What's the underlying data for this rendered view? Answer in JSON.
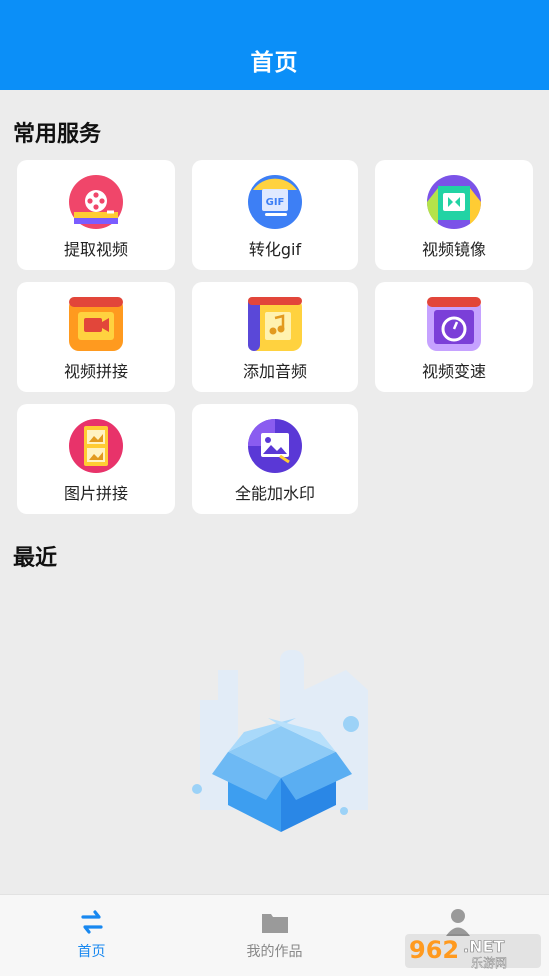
{
  "header": {
    "title": "首页"
  },
  "sections": {
    "services_title": "常用服务",
    "recent_title": "最近"
  },
  "services": [
    {
      "label": "提取视频",
      "icon": "film-reel-icon"
    },
    {
      "label": "转化gif",
      "icon": "gif-icon"
    },
    {
      "label": "视频镜像",
      "icon": "mirror-icon"
    },
    {
      "label": "视频拼接",
      "icon": "video-camera-icon"
    },
    {
      "label": "添加音频",
      "icon": "music-note-icon"
    },
    {
      "label": "视频变速",
      "icon": "speedometer-icon"
    },
    {
      "label": "图片拼接",
      "icon": "image-collage-icon"
    },
    {
      "label": "全能加水印",
      "icon": "image-watermark-icon"
    }
  ],
  "tabbar": [
    {
      "label": "首页",
      "icon": "home-swap-icon",
      "active": true
    },
    {
      "label": "我的作品",
      "icon": "folder-icon",
      "active": false
    },
    {
      "label": "",
      "icon": "user-icon",
      "active": false
    }
  ],
  "watermark": {
    "text1": "962",
    "text2": ".NET",
    "text3": "乐游网"
  },
  "colors": {
    "header": "#0b8ff8",
    "accent": "#1888f0",
    "background": "#ececec"
  }
}
